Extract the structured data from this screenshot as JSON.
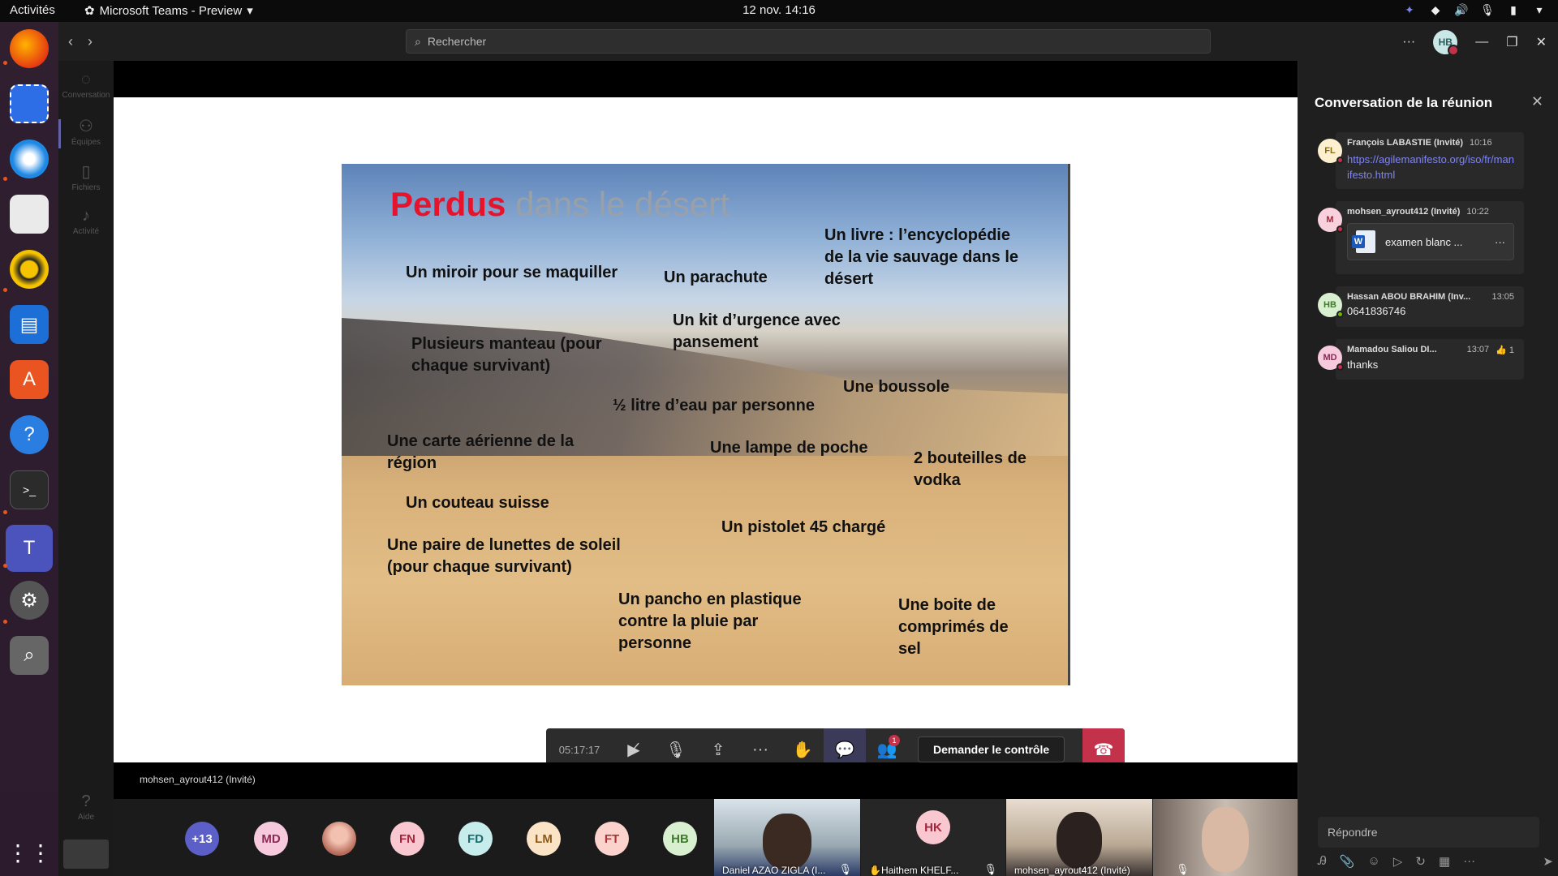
{
  "topbar": {
    "activities": "Activités",
    "app_name": "Microsoft Teams - Preview",
    "clock": "12 nov.  14:16"
  },
  "teams": {
    "search_placeholder": "Rechercher",
    "user_initials": "HB",
    "more_label": "···"
  },
  "rail": [
    {
      "label": "Conversation",
      "icon": "chat-icon"
    },
    {
      "label": "Équipes",
      "icon": "teams-icon"
    },
    {
      "label": "Fichiers",
      "icon": "files-icon"
    },
    {
      "label": "Activité",
      "icon": "bell-icon"
    },
    {
      "label": "Aide",
      "icon": "help-icon"
    }
  ],
  "slide": {
    "title_red": "Perdus",
    "title_grey": "dans le désert",
    "items": [
      "Un miroir pour se maquiller",
      "Un parachute",
      "Un livre : l’encyclopédie de la vie sauvage dans le désert",
      "Un kit d’urgence avec pansement",
      "Plusieurs manteau (pour chaque survivant)",
      "Une boussole",
      "½ litre d’eau par personne",
      "Une carte aérienne de la région",
      "Une lampe de poche",
      "2 bouteilles de vodka",
      "Un couteau suisse",
      "Un pistolet 45 chargé",
      "Une paire de lunettes de soleil (pour chaque survivant)",
      "Un pancho en plastique contre la pluie par personne",
      "Une boite de comprimés de sel"
    ]
  },
  "controls": {
    "timer": "05:17:17",
    "participants_badge": "1",
    "request_control": "Demander le contrôle"
  },
  "presenter": "mohsen_ayrout412 (Invité)",
  "participants": [
    {
      "initials": "+13",
      "bg": "#5b5fc7",
      "fg": "#ffffff"
    },
    {
      "initials": "MD",
      "bg": "#f6c9dd",
      "fg": "#8a2b55"
    },
    {
      "initials": "",
      "bg": "#b76a5a",
      "fg": "#ffffff"
    },
    {
      "initials": "FN",
      "bg": "#f9c7cf",
      "fg": "#a4263c"
    },
    {
      "initials": "FD",
      "bg": "#c6ecec",
      "fg": "#1f6b6b"
    },
    {
      "initials": "LM",
      "bg": "#fbe3c6",
      "fg": "#8a5a1a"
    },
    {
      "initials": "FT",
      "bg": "#fbd3cc",
      "fg": "#a4373a"
    },
    {
      "initials": "HB",
      "bg": "#d8efd0",
      "fg": "#3f7a2e"
    }
  ],
  "video_tiles": [
    {
      "name": "Daniel AZAO ZIGLA (I...",
      "type": "video"
    },
    {
      "name": "Haithem KHELF...",
      "initials": "HK",
      "type": "avatar"
    },
    {
      "name": "mohsen_ayrout412 (Invité)",
      "type": "video"
    },
    {
      "name": "",
      "type": "video"
    }
  ],
  "chat": {
    "title": "Conversation de la réunion",
    "messages": [
      {
        "initials": "FL",
        "author": "François LABASTIE (Invité)",
        "time": "10:16",
        "body": "https://agilemanifesto.org/iso/fr/manifesto.html",
        "status": "#c4314b",
        "av_bg": "#fdf0cf",
        "av_fg": "#8a6a12"
      },
      {
        "initials": "M",
        "author": "mohsen_ayrout412 (Invité)",
        "time": "10:22",
        "file": "examen blanc ...",
        "status": "#c4314b",
        "av_bg": "#f8d1dc",
        "av_fg": "#a4263c"
      },
      {
        "initials": "HB",
        "author": "Hassan ABOU BRAHIM (Inv...",
        "time": "13:05",
        "body": "0641836746",
        "status": "#6bb700",
        "av_bg": "#d8efd0",
        "av_fg": "#3f7a2e"
      },
      {
        "initials": "MD",
        "author": "Mamadou Saliou DI...",
        "time": "13:07",
        "reaction": "👍 1",
        "body": "thanks",
        "status": "#c4314b",
        "av_bg": "#f6c9dd",
        "av_fg": "#8a2b55"
      }
    ],
    "reply_placeholder": "Répondre"
  }
}
